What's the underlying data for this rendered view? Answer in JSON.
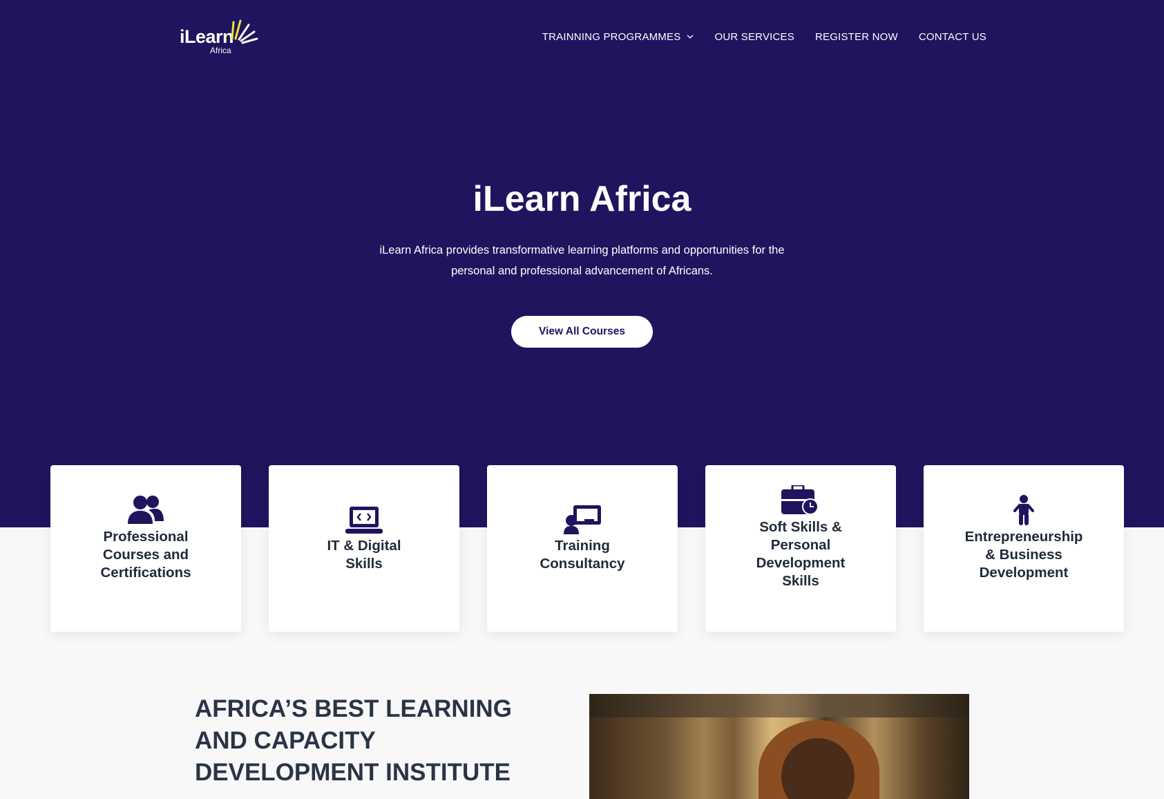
{
  "header": {
    "logo": {
      "word": "iLearn",
      "sub": "Africa"
    },
    "nav": [
      {
        "label": "TRAINNING PROGRAMMES",
        "has_dropdown": true
      },
      {
        "label": "OUR SERVICES"
      },
      {
        "label": "REGISTER NOW"
      },
      {
        "label": "CONTACT US"
      }
    ]
  },
  "hero": {
    "title": "iLearn Africa",
    "description": "iLearn Africa provides transformative learning platforms and opportunities for the personal and professional advancement of Africans.",
    "cta_label": "View All Courses"
  },
  "services": [
    {
      "icon": "users-icon",
      "label": "Professional\nCourses and\nCertifications"
    },
    {
      "icon": "laptop-code-icon",
      "label": "IT & Digital\nSkills"
    },
    {
      "icon": "chalkboard-teacher-icon",
      "label": "Training\nConsultancy"
    },
    {
      "icon": "business-time-icon",
      "label": "Soft Skills &\nPersonal\nDevelopment\nSkills"
    },
    {
      "icon": "child-icon",
      "label": "Entrepreneurship\n& Business\nDevelopment"
    }
  ],
  "about": {
    "title": "AFRICA’S BEST LEARNING\nAND CAPACITY\nDEVELOPMENT INSTITUTE"
  },
  "colors": {
    "hero_bg": "#1f145e",
    "page_bg": "#f8f8f8",
    "accent_yellow": "#f2e33a",
    "heading_text": "#2a3446"
  }
}
